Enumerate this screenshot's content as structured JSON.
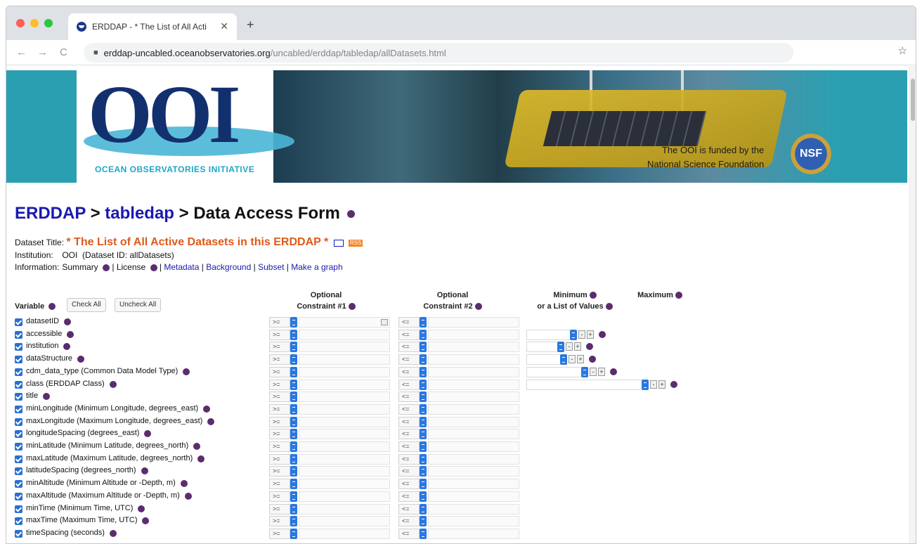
{
  "browser": {
    "tab_title": "ERDDAP - * The List of All Acti",
    "tab_close": "✕",
    "new_tab": "+",
    "back": "←",
    "forward": "→",
    "reload": "C",
    "url_host": "erddap-uncabled.oceanobservatories.org",
    "url_path": "/uncabled/erddap/tabledap/allDatasets.html",
    "bookmark": "☆"
  },
  "banner": {
    "logo": "OOI",
    "tagline": "OCEAN OBSERVATORIES INITIATIVE",
    "funded_line1": "The OOI is funded by the",
    "funded_line2": "National Science Foundation",
    "seal_text": "NSF"
  },
  "breadcrumb": {
    "erddap": "ERDDAP",
    "sep1": " > ",
    "tabledap": "tabledap",
    "sep2": " > ",
    "current": "Data Access Form"
  },
  "dataset": {
    "title_label": "Dataset Title:",
    "title": "* The List of All Active Datasets in this ERDDAP *",
    "rss": "RSS",
    "institution_label": "Institution:",
    "institution": "OOI",
    "dataset_id": "(Dataset ID: allDatasets)",
    "information_label": "Information:",
    "summary": "Summary",
    "license": "License",
    "metadata": "Metadata",
    "background": "Background",
    "subset": "Subset",
    "make_graph": "Make a graph",
    "sep": "|"
  },
  "form": {
    "variable_header": "Variable",
    "check_all": "Check All",
    "uncheck_all": "Uncheck All",
    "constraint1_line1": "Optional",
    "constraint1_line2": "Constraint #1",
    "constraint2_line1": "Optional",
    "constraint2_line2": "Constraint #2",
    "minimum_line1": "Minimum",
    "minimum_line2": "or a List of Values",
    "maximum": "Maximum",
    "op_ge": ">=",
    "op_le": "<=",
    "minus": "-",
    "plus": "+",
    "variables": [
      "datasetID",
      "accessible",
      "institution",
      "dataStructure",
      "cdm_data_type (Common Data Model Type)",
      "class (ERDDAP Class)",
      "title",
      "minLongitude (Minimum Longitude, degrees_east)",
      "maxLongitude (Maximum Longitude, degrees_east)",
      "longitudeSpacing (degrees_east)",
      "minLatitude (Minimum Latitude, degrees_north)",
      "maxLatitude (Maximum Latitude, degrees_north)",
      "latitudeSpacing (degrees_north)",
      "minAltitude (Minimum Altitude or -Depth, m)",
      "maxAltitude (Maximum Altitude or -Depth, m)",
      "minTime (Minimum Time, UTC)",
      "maxTime (Maximum Time, UTC)",
      "timeSpacing (seconds)"
    ]
  }
}
